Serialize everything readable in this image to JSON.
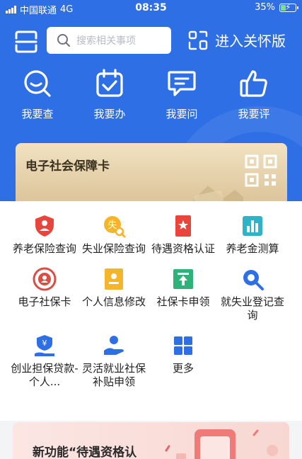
{
  "status_bar": {
    "carrier": "中国联通",
    "network": "4G",
    "time": "08:35",
    "battery": "35%",
    "battery_level": 0.35
  },
  "header": {
    "search_placeholder": "搜索相关事项",
    "care_label": "进入关怀版"
  },
  "quick_actions": [
    {
      "label": "我要查",
      "icon": "search-chat-icon"
    },
    {
      "label": "我要办",
      "icon": "calendar-check-icon"
    },
    {
      "label": "我要问",
      "icon": "chat-icon"
    },
    {
      "label": "我要评",
      "icon": "thumbs-up-icon"
    }
  ],
  "card": {
    "title": "电子社会保障卡",
    "icon": "qr-code-icon"
  },
  "services": [
    {
      "label": "养老保险查询",
      "icon": "pension-shield-icon",
      "color": "#e8453c"
    },
    {
      "label": "失业保险查询",
      "icon": "unemployment-search-icon",
      "color": "#f5b52b"
    },
    {
      "label": "待遇资格认证",
      "icon": "qualification-bookmark-icon",
      "color": "#e8453c"
    },
    {
      "label": "养老金测算",
      "icon": "bar-chart-icon",
      "color": "#2fb3c6"
    },
    {
      "label": "电子社保卡",
      "icon": "social-card-badge-icon",
      "color": "#d94f45"
    },
    {
      "label": "个人信息修改",
      "icon": "id-card-icon",
      "color": "#f5b52b"
    },
    {
      "label": "社保卡申领",
      "icon": "card-apply-icon",
      "color": "#2fb27a"
    },
    {
      "label": "就失业登记查询",
      "icon": "magnifier-icon",
      "color": "#2f6fe6"
    },
    {
      "label": "创业担保贷款-个人...",
      "icon": "loan-yen-icon",
      "color": "#2f6fe6"
    },
    {
      "label": "灵活就业社保补贴申领",
      "icon": "hand-person-icon",
      "color": "#2f6fe6"
    },
    {
      "label": "更多",
      "icon": "grid-more-icon",
      "color": "#2f6fe6"
    }
  ],
  "promo": {
    "text": "新功能“待遇资格认"
  }
}
